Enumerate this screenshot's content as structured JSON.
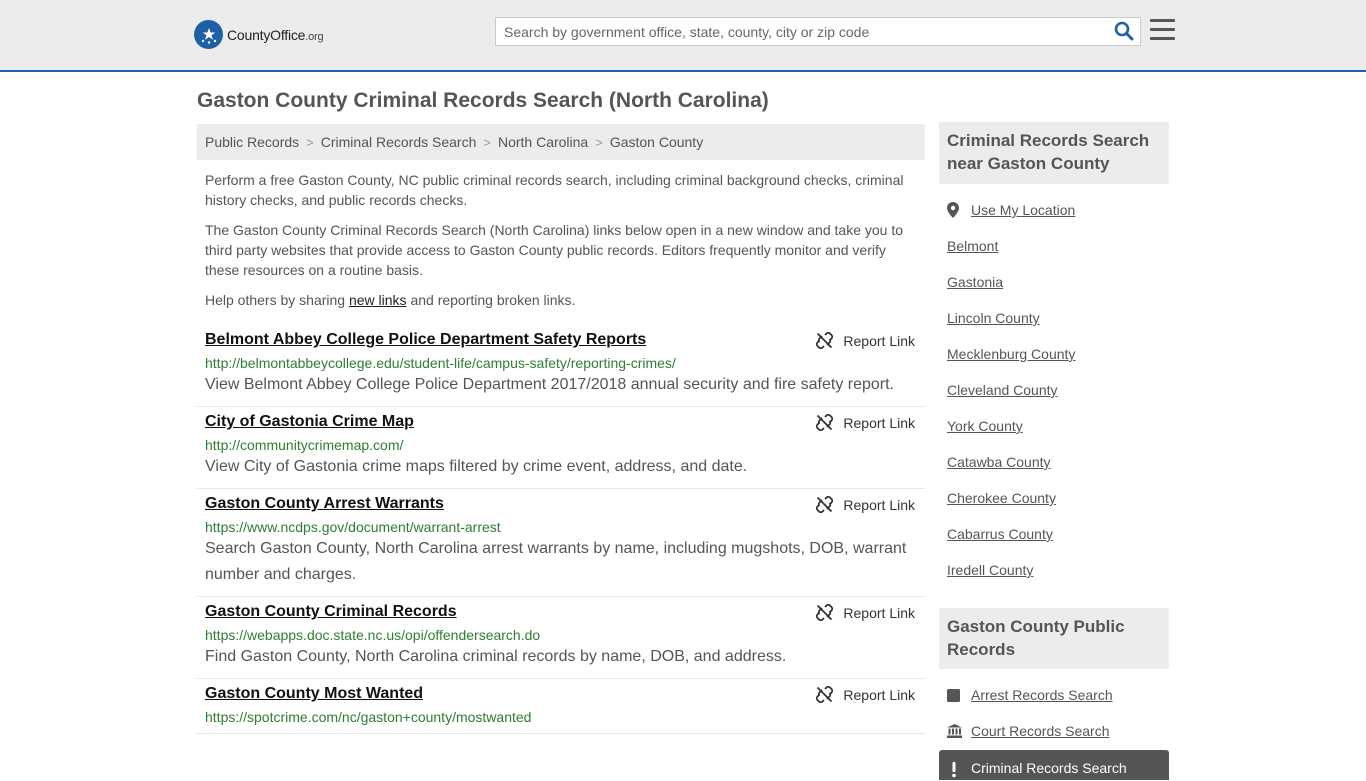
{
  "header": {
    "logo_name": "CountyOffice",
    "logo_tld": ".org",
    "search_placeholder": "Search by government office, state, county, city or zip code"
  },
  "page_title": "Gaston County Criminal Records Search (North Carolina)",
  "breadcrumb": [
    "Public Records",
    "Criminal Records Search",
    "North Carolina",
    "Gaston County"
  ],
  "intro": {
    "p1": "Perform a free Gaston County, NC public criminal records search, including criminal background checks, criminal history checks, and public records checks.",
    "p2": "The Gaston County Criminal Records Search (North Carolina) links below open in a new window and take you to third party websites that provide access to Gaston County public records. Editors frequently monitor and verify these resources on a routine basis.",
    "p3_before": "Help others by sharing ",
    "p3_link": "new links",
    "p3_after": " and reporting broken links."
  },
  "report_label": "Report Link",
  "results": [
    {
      "title": "Belmont Abbey College Police Department Safety Reports",
      "url": "http://belmontabbeycollege.edu/student-life/campus-safety/reporting-crimes/",
      "desc": "View Belmont Abbey College Police Department 2017/2018 annual security and fire safety report."
    },
    {
      "title": "City of Gastonia Crime Map",
      "url": "http://communitycrimemap.com/",
      "desc": "View City of Gastonia crime maps filtered by crime event, address, and date."
    },
    {
      "title": "Gaston County Arrest Warrants",
      "url": "https://www.ncdps.gov/document/warrant-arrest",
      "desc": "Search Gaston County, North Carolina arrest warrants by name, including mugshots, DOB, warrant number and charges."
    },
    {
      "title": "Gaston County Criminal Records",
      "url": "https://webapps.doc.state.nc.us/opi/offendersearch.do",
      "desc": "Find Gaston County, North Carolina criminal records by name, DOB, and address."
    },
    {
      "title": "Gaston County Most Wanted",
      "url": "https://spotcrime.com/nc/gaston+county/mostwanted",
      "desc": ""
    }
  ],
  "sidebar": {
    "nearby_title": "Criminal Records Search near Gaston County",
    "use_location": "Use My Location",
    "nearby": [
      "Belmont",
      "Gastonia",
      "Lincoln County",
      "Mecklenburg County",
      "Cleveland County",
      "York County",
      "Catawba County",
      "Cherokee County",
      "Cabarrus County",
      "Iredell County"
    ],
    "public_title": "Gaston County Public Records",
    "public_links": [
      {
        "label": "Arrest Records Search",
        "icon": "square-icon"
      },
      {
        "label": "Court Records Search",
        "icon": "courthouse-icon"
      }
    ],
    "active_link": {
      "label": "Criminal Records Search",
      "icon": "exclamation-icon"
    }
  },
  "colors": {
    "brand_blue": "#1f5fa5",
    "url_green": "#2e7d32",
    "sidebar_active": "#555555"
  }
}
